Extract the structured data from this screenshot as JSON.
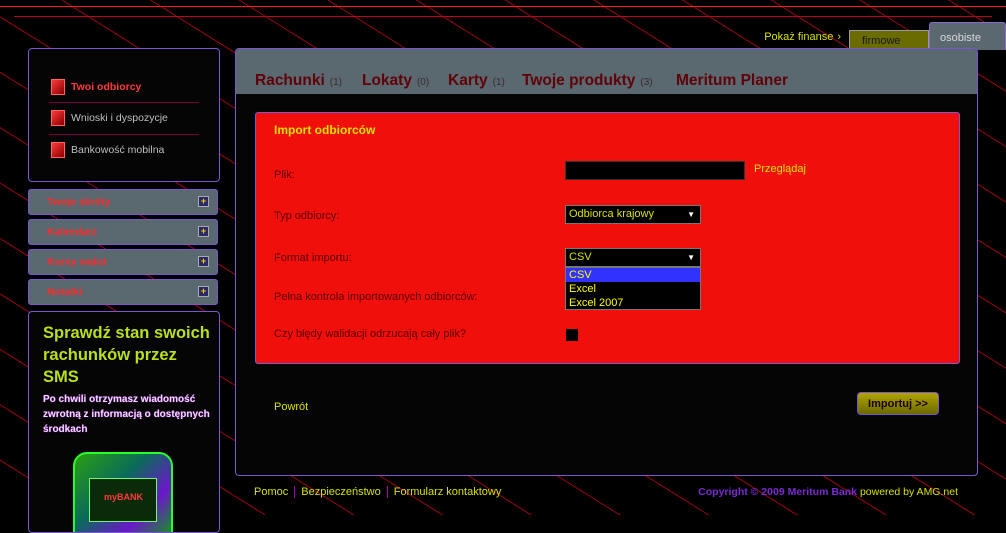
{
  "top_nav": {
    "show_finance": "Pokaż finanse",
    "tab_business": "firmowe",
    "tab_personal": "osobiste"
  },
  "sidebar": {
    "menu": [
      {
        "label": "Twoi odbiorcy",
        "active": true
      },
      {
        "label": "Wnioski i dyspozycje",
        "active": false
      },
      {
        "label": "Bankowość mobilna",
        "active": false
      }
    ],
    "boxes": [
      "Twoje skróty",
      "Kalendarz",
      "Kursy walut",
      "Notatki"
    ],
    "promo": {
      "heading": "Sprawdź stan swoich rachunków przez SMS",
      "text": "Po chwili otrzymasz wiadomość zwrotną z informacją o dostępnych środkach",
      "phone_screen": "myBANK"
    }
  },
  "main_tabs": [
    {
      "label": "Rachunki",
      "count": "(1)"
    },
    {
      "label": "Lokaty",
      "count": "(0)"
    },
    {
      "label": "Karty",
      "count": "(1)"
    },
    {
      "label": "Twoje produkty",
      "count": "(3)"
    },
    {
      "label": "Meritum Planer",
      "count": ""
    }
  ],
  "form": {
    "title": "Import odbiorców",
    "file_label": "Plik:",
    "browse": "Przeglądaj",
    "type_label": "Typ odbiorcy:",
    "type_value": "Odbiorca krajowy",
    "format_label": "Format importu:",
    "format_value": "CSV",
    "format_options": [
      "CSV",
      "Excel",
      "Excel 2007"
    ],
    "control_label": "Pełna kontrola importowanych odbiorców:",
    "errors_label": "Czy błędy walidacji odrzucają cały plik?"
  },
  "back": "Powrót",
  "import_button": "Importuj >>",
  "footer": {
    "links": [
      "Pomoc",
      "Bezpieczeństwo",
      "Formularz kontaktowy"
    ],
    "copyright": "Copyright © 2009 Meritum Bank",
    "powered": "powered by AMG.net"
  },
  "colors": {
    "accent_yellow": "#d7e100",
    "form_red": "#f00f0a",
    "tab_gray": "#5a6870",
    "border_purple": "#7a57d0"
  }
}
